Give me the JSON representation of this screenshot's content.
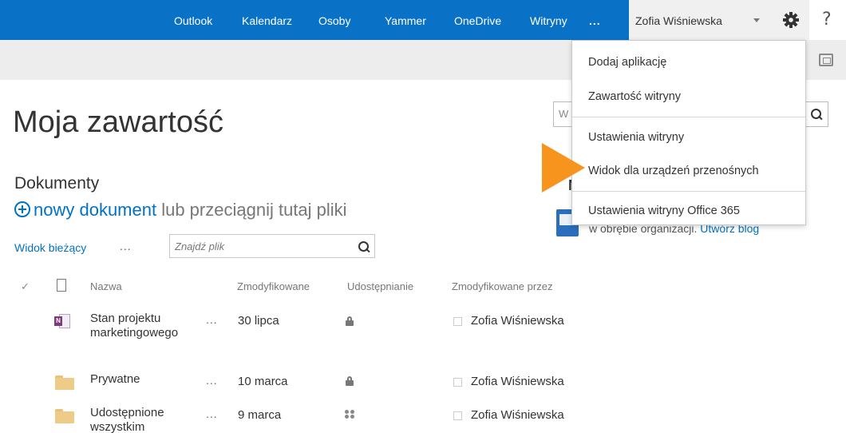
{
  "suite_nav": {
    "links": [
      "Outlook",
      "Kalendarz",
      "Osoby",
      "Yammer",
      "OneDrive",
      "Witryny"
    ],
    "more": "...",
    "user_name": "Zofia Wiśniewska",
    "help": "?"
  },
  "page": {
    "title": "Moja zawartość",
    "section_title": "Dokumenty",
    "new_doc_link": "nowy dokument",
    "new_doc_rest": " lub przeciągnij tutaj pliki",
    "view_label": "Widok bieżący",
    "view_more": "...",
    "find_placeholder": "Znajdź plik"
  },
  "table": {
    "headers": {
      "name": "Nazwa",
      "modified": "Zmodyfikowane",
      "sharing": "Udostępnianie",
      "modified_by": "Zmodyfikowane przez"
    },
    "check_glyph": "✓",
    "rows": [
      {
        "icon": "onenote-icon",
        "name": "Stan projektu marketingowego",
        "more": "...",
        "date": "30 lipca",
        "sharing": "lock-icon",
        "modified_by": "Zofia Wiśniewska"
      },
      {
        "icon": "folder-icon",
        "name": "Prywatne",
        "more": "...",
        "date": "10 marca",
        "sharing": "lock-icon",
        "modified_by": "Zofia Wiśniewska"
      },
      {
        "icon": "folder-icon",
        "name": "Udostępnione wszystkim",
        "more": "...",
        "date": "9 marca",
        "sharing": "people-icon",
        "modified_by": "Zofia Wiśniewska"
      }
    ]
  },
  "side": {
    "search_text": "W",
    "heading": "No",
    "blog_text": "w obrębie organizacji. ",
    "blog_link": "Utwórz blog"
  },
  "menu": {
    "items": [
      "Dodaj aplikację",
      "Zawartość witryny",
      "Ustawienia witryny",
      "Widok dla urządzeń przenośnych",
      "Ustawienia witryny Office 365"
    ]
  },
  "colors": {
    "suite_bar": "#0a72c6",
    "accent_link": "#0072c6",
    "callout": "#f7941d"
  }
}
